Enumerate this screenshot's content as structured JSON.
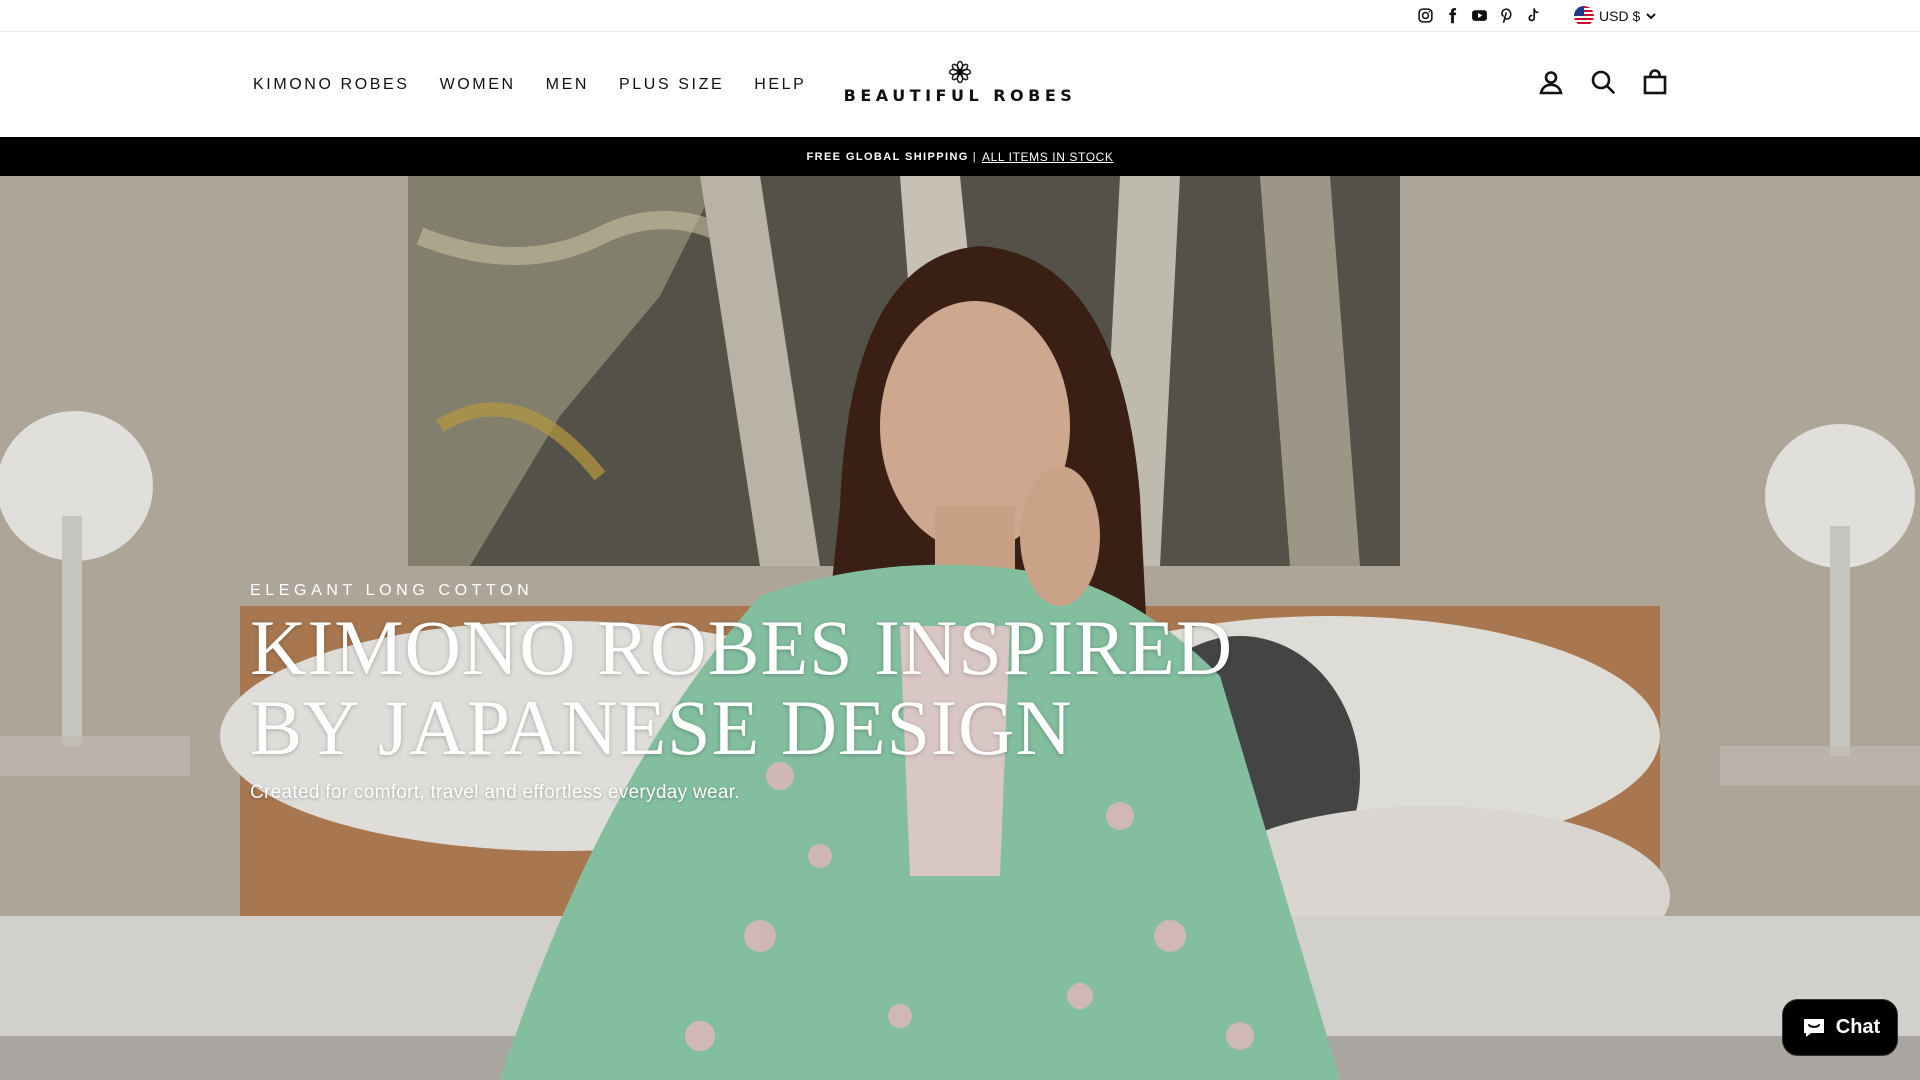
{
  "utility": {
    "social_icons": [
      "instagram-icon",
      "facebook-icon",
      "youtube-icon",
      "pinterest-icon",
      "tiktok-icon"
    ],
    "currency_label": "USD $"
  },
  "header": {
    "nav": [
      "KIMONO ROBES",
      "WOMEN",
      "MEN",
      "PLUS SIZE",
      "HELP"
    ],
    "brand": "BEAUTIFUL ROBES",
    "icons": [
      "account-icon",
      "search-icon",
      "cart-icon"
    ]
  },
  "announcement": {
    "text": "FREE GLOBAL SHIPPING",
    "separator": "|",
    "link": "ALL ITEMS IN STOCK"
  },
  "hero": {
    "eyebrow": "ELEGANT LONG COTTON",
    "headline_line1": "KIMONO ROBES INSPIRED",
    "headline_line2": "BY JAPANESE DESIGN",
    "subheading": "Created for comfort, travel and effortless everyday wear."
  },
  "chat": {
    "label": "Chat"
  },
  "colors": {
    "announcement_bg": "#000000",
    "robe_green": "#8fcfad",
    "text_dark": "#111111"
  }
}
